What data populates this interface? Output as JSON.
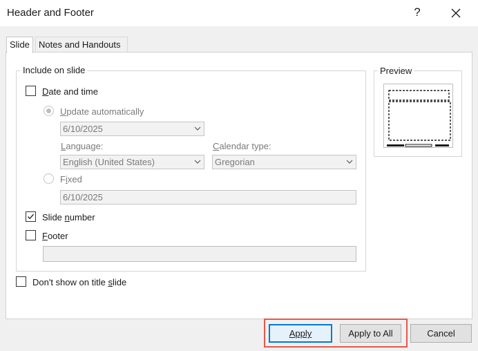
{
  "dialog": {
    "title": "Header and Footer",
    "help_glyph": "?",
    "colors": {
      "highlight": "#e8564a",
      "default_button_border": "#0078d7"
    }
  },
  "tabs": [
    {
      "label": "Slide",
      "active": true
    },
    {
      "label": "Notes and Handouts",
      "active": false
    }
  ],
  "include_group": {
    "label": "Include on slide",
    "date_time": {
      "label": "Date and time",
      "checked": false,
      "update_auto": {
        "label": "Update automatically",
        "selected": true,
        "date_value": "6/10/2025",
        "language_label": "Language:",
        "language_value": "English (United States)",
        "calendar_label": "Calendar type:",
        "calendar_value": "Gregorian"
      },
      "fixed": {
        "label": "Fixed",
        "selected": false,
        "value": "6/10/2025"
      }
    },
    "slide_number": {
      "label": "Slide number",
      "checked": true
    },
    "footer": {
      "label": "Footer",
      "checked": false,
      "value": ""
    }
  },
  "dont_show_title": {
    "label": "Don't show on title slide",
    "checked": false
  },
  "preview": {
    "label": "Preview"
  },
  "buttons": {
    "apply": "Apply",
    "apply_all": "Apply to All",
    "cancel": "Cancel"
  }
}
